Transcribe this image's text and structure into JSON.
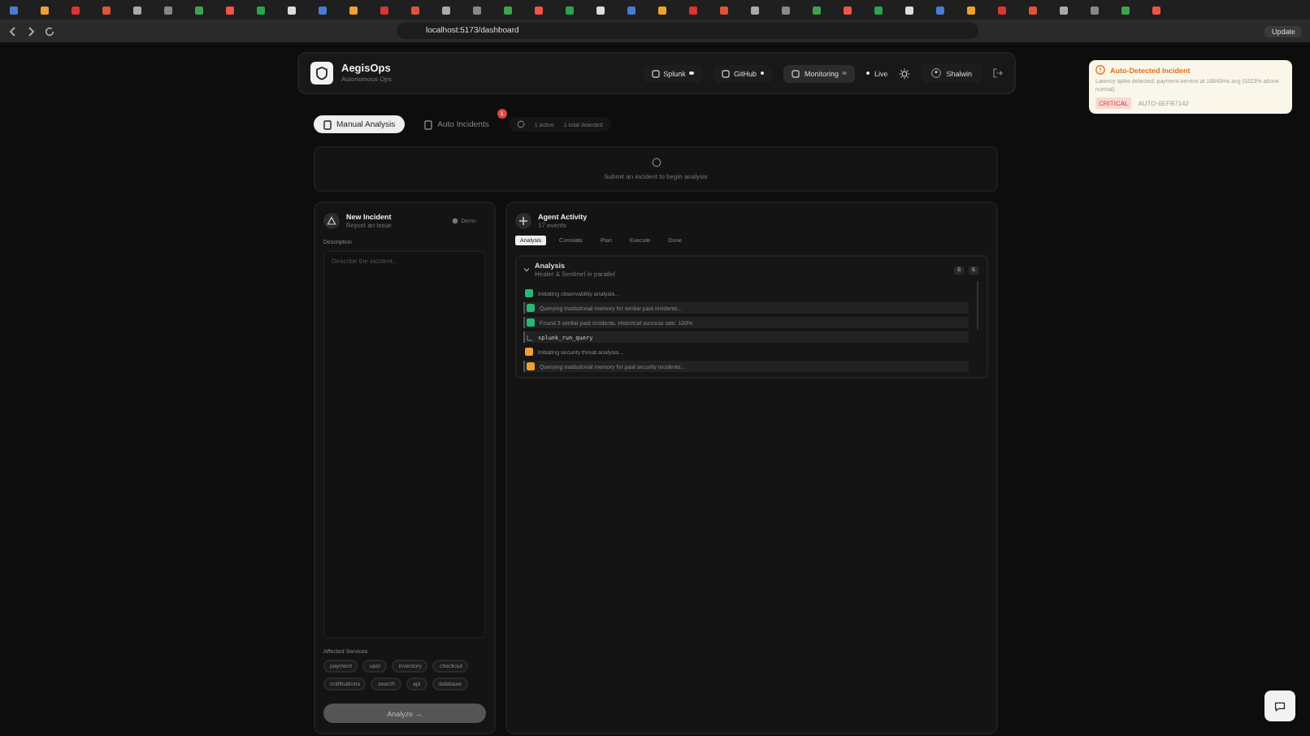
{
  "browser": {
    "url": "localhost:5173/dashboard",
    "update_button": "Update"
  },
  "header": {
    "app_name": "AegisOps",
    "subtitle": "Autonomous Ops",
    "live": "Live",
    "user": "Shalwin",
    "integrations": [
      {
        "label": "Splunk",
        "connected": true,
        "selected": false
      },
      {
        "label": "GitHub",
        "connected": true,
        "selected": false
      },
      {
        "label": "Monitoring",
        "connected": false,
        "selected": true
      }
    ]
  },
  "mode_tabs": [
    {
      "label": "Manual Analysis",
      "selected": true
    },
    {
      "label": "Auto Incidents",
      "selected": false,
      "badge": "1"
    }
  ],
  "stats": [
    "1 active",
    "1 total detected"
  ],
  "status_message": "Submit an incident to begin analysis",
  "new_incident": {
    "title": "New Incident",
    "subtitle": "Report an issue",
    "demo": "Demo",
    "description_label": "Description",
    "description_placeholder": "Describe the incident...",
    "services_label": "Affected Services",
    "services": [
      "payment",
      "user",
      "inventory",
      "checkout",
      "notifications",
      "search",
      "api",
      "database"
    ],
    "analyze_button": "Analyze →"
  },
  "agent_activity": {
    "title": "Agent Activity",
    "events": "17 events",
    "steps": [
      {
        "label": "Analysis",
        "selected": true
      },
      {
        "label": "Correlate",
        "selected": false
      },
      {
        "label": "Plan",
        "selected": false
      },
      {
        "label": "Execute",
        "selected": false
      },
      {
        "label": "Done",
        "selected": false
      }
    ],
    "section": {
      "title": "Analysis",
      "subtitle": "Healer & Sentinel in parallel",
      "expanded": true,
      "badges": [
        "6",
        "6"
      ],
      "log": [
        {
          "kind": "message",
          "color": "#2bb673",
          "highlighted": false,
          "text": "Initiating observability analysis..."
        },
        {
          "kind": "message",
          "color": "#2bb673",
          "highlighted": true,
          "text": "Querying institutional memory for similar past incidents..."
        },
        {
          "kind": "message",
          "color": "#2bb673",
          "highlighted": true,
          "text": "Found 3 similar past incidents. Historical success rate: 100%"
        },
        {
          "kind": "tool",
          "highlighted": true,
          "text": "splunk_run_query"
        },
        {
          "kind": "message",
          "color": "#f0a030",
          "highlighted": false,
          "text": "Initiating security threat analysis..."
        },
        {
          "kind": "message",
          "color": "#f0a030",
          "highlighted": true,
          "text": "Querying institutional memory for past security incidents..."
        }
      ]
    }
  },
  "notification": {
    "title": "Auto-Detected Incident",
    "message": "Latency spike detected: payment-service at 10640ms avg (5323% above normal)",
    "severity": "CRITICAL",
    "id": "AUTO-6EFB7142"
  }
}
